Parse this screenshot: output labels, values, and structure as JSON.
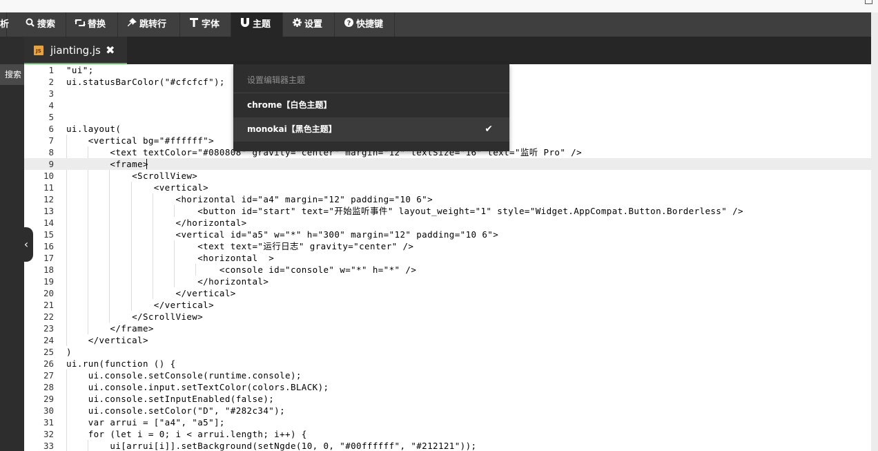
{
  "menubar": {
    "items": [
      {
        "label": "析",
        "icon": ""
      },
      {
        "label": "搜索",
        "icon": "search-icon"
      },
      {
        "label": "替换",
        "icon": "retweet-icon"
      },
      {
        "label": "跳转行",
        "icon": "pin-icon"
      },
      {
        "label": "字体",
        "icon": "text-cursor-icon"
      },
      {
        "label": "主题",
        "icon": "magnet-icon"
      },
      {
        "label": "设置",
        "icon": "gear-icon"
      },
      {
        "label": "快捷键",
        "icon": "question-circle-icon"
      }
    ],
    "active": "主题"
  },
  "tab": {
    "filename": "jianting.js",
    "file_icon_text": "JS",
    "close_glyph": "✖"
  },
  "sidebar": {
    "search_label": "搜索",
    "collapse_glyph": "‹"
  },
  "theme_dropdown": {
    "title": "设置编辑器主题",
    "options": [
      {
        "label": "chrome【白色主题】",
        "selected": false
      },
      {
        "label": "monokai【黑色主题】",
        "selected": true
      }
    ],
    "check_glyph": "✔"
  },
  "colors": {
    "menubar": "#3f3f3f",
    "active_tab_indicator": "#5cb85c",
    "dropdown_bg": "#2e2e2e",
    "current_line": "#ececec"
  },
  "editor": {
    "highlighted_line": 9,
    "lines": [
      {
        "n": "1",
        "text": "\"ui\";"
      },
      {
        "n": "2",
        "text": "ui.statusBarColor(\"#cfcfcf\");"
      },
      {
        "n": "3",
        "text": ""
      },
      {
        "n": "4",
        "text": ""
      },
      {
        "n": "5",
        "text": ""
      },
      {
        "n": "6",
        "text": "ui.layout("
      },
      {
        "n": "7",
        "text": "    <vertical bg=\"#ffffff\">"
      },
      {
        "n": "8",
        "text": "        <text textColor=\"#080808\" gravity=\"center\" margin=\"12\" textSize=\"16\" text=\"监听 Pro\" />"
      },
      {
        "n": "9",
        "text": "        <frame>"
      },
      {
        "n": "10",
        "text": "            <ScrollView>"
      },
      {
        "n": "11",
        "text": "                <vertical>"
      },
      {
        "n": "12",
        "text": "                    <horizontal id=\"a4\" margin=\"12\" padding=\"10 6\">"
      },
      {
        "n": "13",
        "text": "                        <button id=\"start\" text=\"开始监听事件\" layout_weight=\"1\" style=\"Widget.AppCompat.Button.Borderless\" />"
      },
      {
        "n": "14",
        "text": "                    </horizontal>"
      },
      {
        "n": "15",
        "text": "                    <vertical id=\"a5\" w=\"*\" h=\"300\" margin=\"12\" padding=\"10 6\">"
      },
      {
        "n": "16",
        "text": "                        <text text=\"运行日志\" gravity=\"center\" />"
      },
      {
        "n": "17",
        "text": "                        <horizontal  >"
      },
      {
        "n": "18",
        "text": "                            <console id=\"console\" w=\"*\" h=\"*\" />"
      },
      {
        "n": "19",
        "text": "                        </horizontal>"
      },
      {
        "n": "20",
        "text": "                    </vertical>"
      },
      {
        "n": "21",
        "text": "                </vertical>"
      },
      {
        "n": "22",
        "text": "            </ScrollView>"
      },
      {
        "n": "23",
        "text": "        </frame>"
      },
      {
        "n": "24",
        "text": "    </vertical>"
      },
      {
        "n": "25",
        "text": ")"
      },
      {
        "n": "26",
        "text": "ui.run(function () {"
      },
      {
        "n": "27",
        "text": "    ui.console.setConsole(runtime.console);"
      },
      {
        "n": "28",
        "text": "    ui.console.input.setTextColor(colors.BLACK);"
      },
      {
        "n": "29",
        "text": "    ui.console.setInputEnabled(false);"
      },
      {
        "n": "30",
        "text": "    ui.console.setColor(\"D\", \"#282c34\");"
      },
      {
        "n": "31",
        "text": "    var arrui = [\"a4\", \"a5\"];"
      },
      {
        "n": "32",
        "text": "    for (let i = 0; i < arrui.length; i++) {"
      },
      {
        "n": "33",
        "text": "        ui[arrui[i]].setBackground(setNgde(10, 0, \"#00ffffff\", \"#212121\"));"
      }
    ]
  }
}
